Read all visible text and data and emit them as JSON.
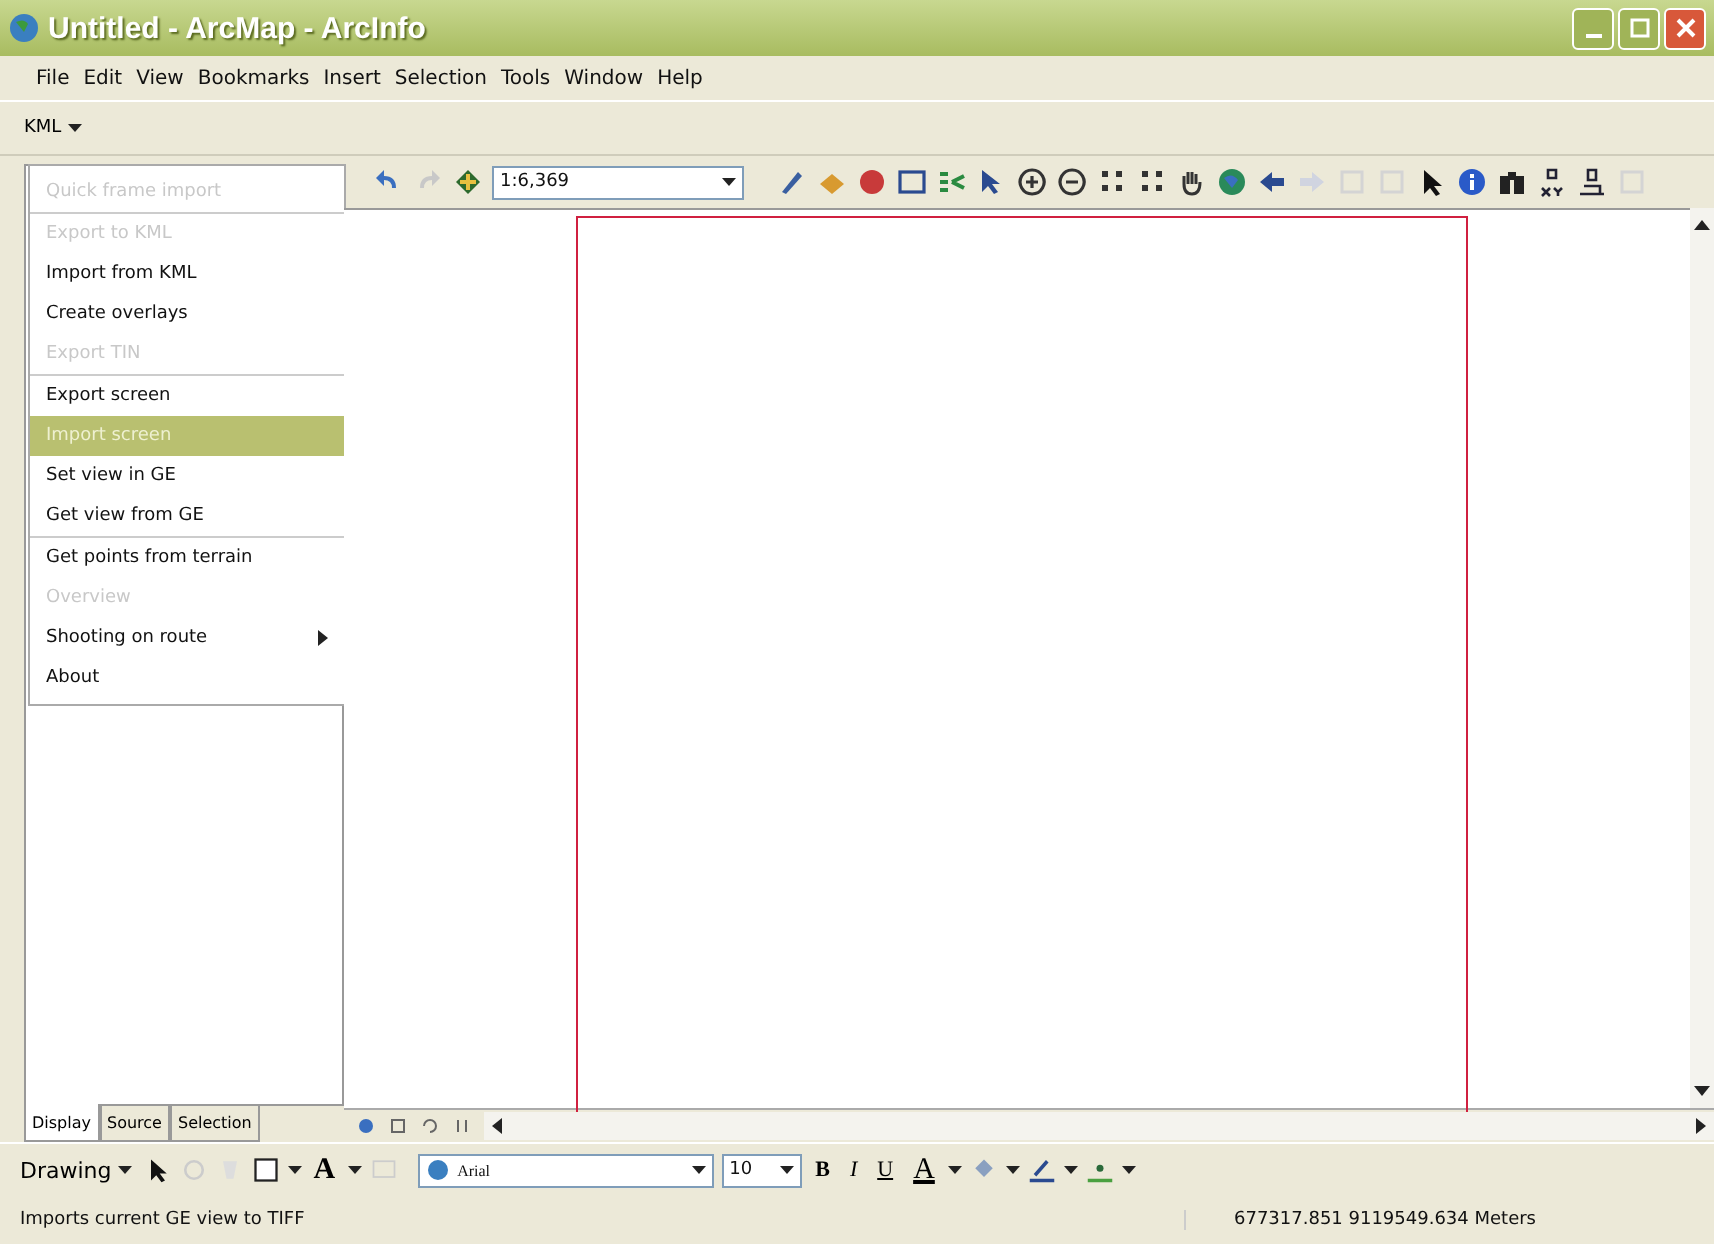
{
  "window": {
    "title": "Untitled - ArcMap - ArcInfo"
  },
  "menubar": [
    "File",
    "Edit",
    "View",
    "Bookmarks",
    "Insert",
    "Selection",
    "Tools",
    "Window",
    "Help"
  ],
  "kml_toolbar": {
    "label": "KML"
  },
  "kml_menu": [
    {
      "label": "Quick frame import",
      "disabled": true,
      "selected": false,
      "separator_after": true,
      "submenu": false
    },
    {
      "label": "Export to KML",
      "disabled": true,
      "selected": false,
      "separator_after": false,
      "submenu": false
    },
    {
      "label": "Import from KML",
      "disabled": false,
      "selected": false,
      "separator_after": false,
      "submenu": false
    },
    {
      "label": "Create overlays",
      "disabled": false,
      "selected": false,
      "separator_after": false,
      "submenu": false
    },
    {
      "label": "Export TIN",
      "disabled": true,
      "selected": false,
      "separator_after": true,
      "submenu": false
    },
    {
      "label": "Export screen",
      "disabled": false,
      "selected": false,
      "separator_after": false,
      "submenu": false
    },
    {
      "label": "Import screen",
      "disabled": false,
      "selected": true,
      "separator_after": false,
      "submenu": false
    },
    {
      "label": "Set view in GE",
      "disabled": false,
      "selected": false,
      "separator_after": false,
      "submenu": false
    },
    {
      "label": "Get view from GE",
      "disabled": false,
      "selected": false,
      "separator_after": true,
      "submenu": false
    },
    {
      "label": "Get points from terrain",
      "disabled": false,
      "selected": false,
      "separator_after": false,
      "submenu": false
    },
    {
      "label": "Overview",
      "disabled": true,
      "selected": false,
      "separator_after": false,
      "submenu": false
    },
    {
      "label": "Shooting on route",
      "disabled": false,
      "selected": false,
      "separator_after": false,
      "submenu": true
    },
    {
      "label": "About",
      "disabled": false,
      "selected": false,
      "separator_after": false,
      "submenu": false
    }
  ],
  "scale": "1:6,369",
  "toc_tabs": [
    {
      "label": "Display",
      "selected": true
    },
    {
      "label": "Source",
      "selected": false
    },
    {
      "label": "Selection",
      "selected": false
    }
  ],
  "drawing_toolbar": {
    "label": "Drawing",
    "font": "Arial",
    "font_size": "10",
    "bold": "B",
    "italic": "I",
    "underline": "U",
    "text_tool": "A",
    "font_color": "A"
  },
  "status_bar": {
    "message": "Imports current GE view to TIFF",
    "coordinates": "677317.851  9119549.634 Meters"
  }
}
